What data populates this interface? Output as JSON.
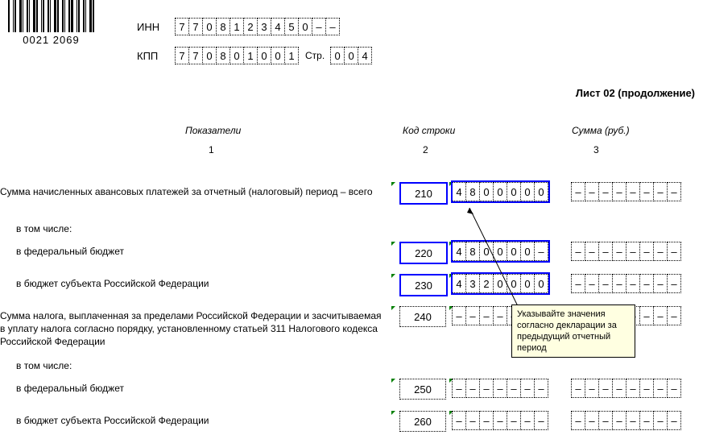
{
  "barcode_number": "0021 2069",
  "header": {
    "inn_label": "ИНН",
    "inn": [
      "7",
      "7",
      "0",
      "8",
      "1",
      "2",
      "3",
      "4",
      "5",
      "0",
      "–",
      "–"
    ],
    "kpp_label": "КПП",
    "kpp": [
      "7",
      "7",
      "0",
      "8",
      "0",
      "1",
      "0",
      "0",
      "1"
    ],
    "str_label": "Стр.",
    "str": [
      "0",
      "0",
      "4"
    ]
  },
  "page_title": "Лист 02 (продолжение)",
  "columns": {
    "indicator": "Показатели",
    "code": "Код строки",
    "sum": "Сумма (руб.)",
    "n1": "1",
    "n2": "2",
    "n3": "3"
  },
  "rows": [
    {
      "text": "Сумма начисленных авансовых платежей за отчетный (налоговый) период – всего",
      "code": "210",
      "sum": [
        "4",
        "8",
        "0",
        "0",
        "0",
        "0",
        "0"
      ],
      "ext": [
        "–",
        "–",
        "–",
        "–",
        "–",
        "–",
        "–",
        "–"
      ],
      "highlight": true,
      "indent": false
    },
    {
      "text": "в том числе:",
      "code": null,
      "indent": true
    },
    {
      "text": "в федеральный бюджет",
      "code": "220",
      "sum": [
        "4",
        "8",
        "0",
        "0",
        "0",
        "0",
        "–"
      ],
      "ext": [
        "–",
        "–",
        "–",
        "–",
        "–",
        "–",
        "–",
        "–"
      ],
      "highlight": true,
      "indent": true
    },
    {
      "text": "в бюджет субъекта Российской Федерации",
      "code": "230",
      "sum": [
        "4",
        "3",
        "2",
        "0",
        "0",
        "0",
        "0"
      ],
      "ext": [
        "–",
        "–",
        "–",
        "–",
        "–",
        "–",
        "–",
        "–"
      ],
      "highlight": true,
      "indent": true
    },
    {
      "text": "Сумма налога, выплаченная за пределами Российской Федерации и засчитываемая в уплату налога согласно порядку, установленному статьей 311 Налогового кодекса Российской Федерации",
      "code": "240",
      "sum": [
        "–",
        "–",
        "–",
        "–",
        "–",
        "–",
        "–"
      ],
      "ext": [
        "–",
        "–",
        "–",
        "–",
        "–",
        "–",
        "–",
        "–"
      ],
      "highlight": false,
      "indent": false
    },
    {
      "text": "в том числе:",
      "code": null,
      "indent": true
    },
    {
      "text": "в федеральный бюджет",
      "code": "250",
      "sum": [
        "–",
        "–",
        "–",
        "–",
        "–",
        "–",
        "–"
      ],
      "ext": [
        "–",
        "–",
        "–",
        "–",
        "–",
        "–",
        "–",
        "–"
      ],
      "highlight": false,
      "indent": true
    },
    {
      "text": "в бюджет субъекта Российской Федерации",
      "code": "260",
      "sum": [
        "–",
        "–",
        "–",
        "–",
        "–",
        "–",
        "–"
      ],
      "ext": [
        "–",
        "–",
        "–",
        "–",
        "–",
        "–",
        "–",
        "–"
      ],
      "highlight": false,
      "indent": true
    }
  ],
  "tooltip": "Указывайте значения согласно декларации за предыдущий отчетный период"
}
